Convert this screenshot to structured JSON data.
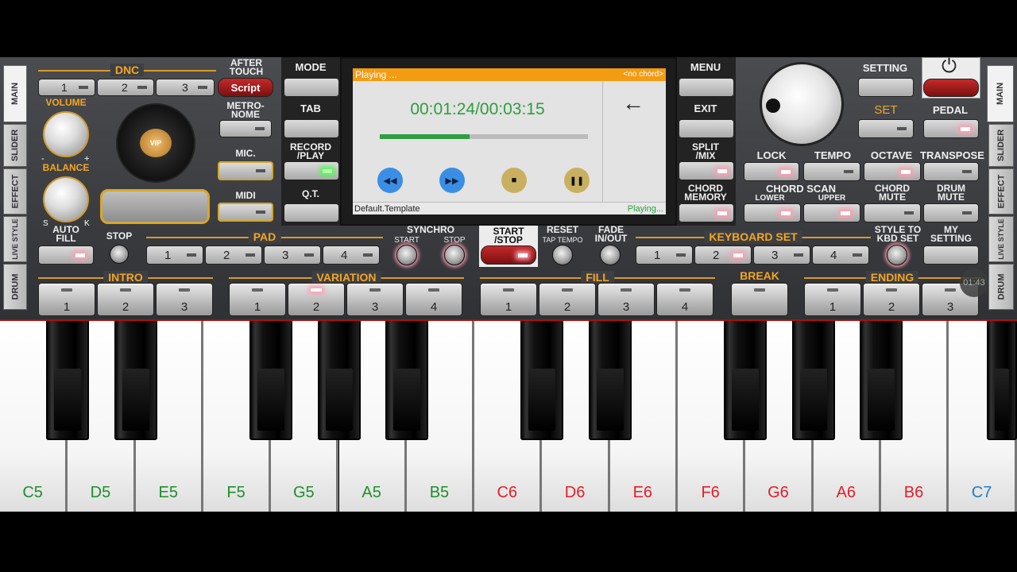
{
  "side_tabs_left": [
    "MAIN",
    "SLIDER",
    "EFFECT",
    "LIVE STYLE",
    "DRUM"
  ],
  "side_tabs_right": [
    "MAIN",
    "SLIDER",
    "EFFECT",
    "LIVE STYLE",
    "DRUM"
  ],
  "dnc": {
    "title": "DNC",
    "buttons": [
      "1",
      "2",
      "3"
    ],
    "script": "Script"
  },
  "after_touch": "AFTER\nTOUCH",
  "metronome": "METRO-\nNOME",
  "mic": "MIC.",
  "midi": "MIDI",
  "volume": "VOLUME",
  "balance": "BALANCE",
  "minus": "-",
  "plus": "+",
  "s": "S",
  "k": "K",
  "vip": "VIP",
  "left_col": {
    "mode": "MODE",
    "tab": "TAB",
    "record": "RECORD\n/PLAY",
    "qt": "Q.T."
  },
  "right_col": {
    "menu": "MENU",
    "exit": "EXIT",
    "split": "SPLIT\n/MIX",
    "chord_memory": "CHORD\nMEMORY"
  },
  "player": {
    "status": "Playing ...",
    "chord": "<no chord>",
    "time": "00:01:24/00:03:15",
    "progress": 0.43,
    "template": "Default.Template",
    "footer_status": "Playing...",
    "back": "←",
    "accent": "#f39c12",
    "time_color": "#2e9e3e"
  },
  "setting": "SETTING",
  "set": "SET",
  "pedal": "PEDAL",
  "power": "⏻",
  "row3": {
    "lock": "LOCK",
    "tempo": "TEMPO",
    "octave": "OCTAVE",
    "transpose": "TRANSPOSE"
  },
  "chord_scan": "CHORD SCAN",
  "lower": "LOWER",
  "upper": "UPPER",
  "chord_mute": "CHORD\nMUTE",
  "drum_mute": "DRUM\nMUTE",
  "auto_fill": "AUTO\nFILL",
  "stop": "STOP",
  "pad": {
    "title": "PAD",
    "buttons": [
      "1",
      "2",
      "3",
      "4"
    ]
  },
  "synchro": "SYNCHRO",
  "synchro_start": "START",
  "synchro_stop": "STOP",
  "start_stop": "START\n/STOP",
  "reset": "RESET",
  "tap_tempo": "TAP TEMPO",
  "fade": "FADE\nIN/OUT",
  "keyboard_set": {
    "title": "KEYBOARD SET",
    "buttons": [
      "1",
      "2",
      "3",
      "4"
    ]
  },
  "style_to_kbd": "STYLE TO\nKBD SET",
  "my_setting": "MY\nSETTING",
  "intro": {
    "title": "INTRO",
    "buttons": [
      "1",
      "2",
      "3"
    ]
  },
  "variation": {
    "title": "VARIATION",
    "buttons": [
      "1",
      "2",
      "3",
      "4"
    ]
  },
  "fill": {
    "title": "FILL",
    "buttons": [
      "1",
      "2",
      "3",
      "4"
    ]
  },
  "break": "BREAK",
  "ending": {
    "title": "ENDING",
    "buttons": [
      "1",
      "2",
      "3"
    ]
  },
  "clock": "01:43",
  "keys": [
    {
      "note": "C5",
      "color": "#1f8f2a"
    },
    {
      "note": "D5",
      "color": "#1f8f2a"
    },
    {
      "note": "E5",
      "color": "#1f8f2a"
    },
    {
      "note": "F5",
      "color": "#1f8f2a"
    },
    {
      "note": "G5",
      "color": "#1f8f2a"
    },
    {
      "note": "A5",
      "color": "#1f8f2a"
    },
    {
      "note": "B5",
      "color": "#1f8f2a"
    },
    {
      "note": "C6",
      "color": "#e0202a"
    },
    {
      "note": "D6",
      "color": "#e0202a"
    },
    {
      "note": "E6",
      "color": "#e0202a"
    },
    {
      "note": "F6",
      "color": "#e0202a"
    },
    {
      "note": "G6",
      "color": "#e0202a"
    },
    {
      "note": "A6",
      "color": "#e0202a"
    },
    {
      "note": "B6",
      "color": "#e0202a"
    },
    {
      "note": "C7",
      "color": "#1e7fc0"
    }
  ]
}
